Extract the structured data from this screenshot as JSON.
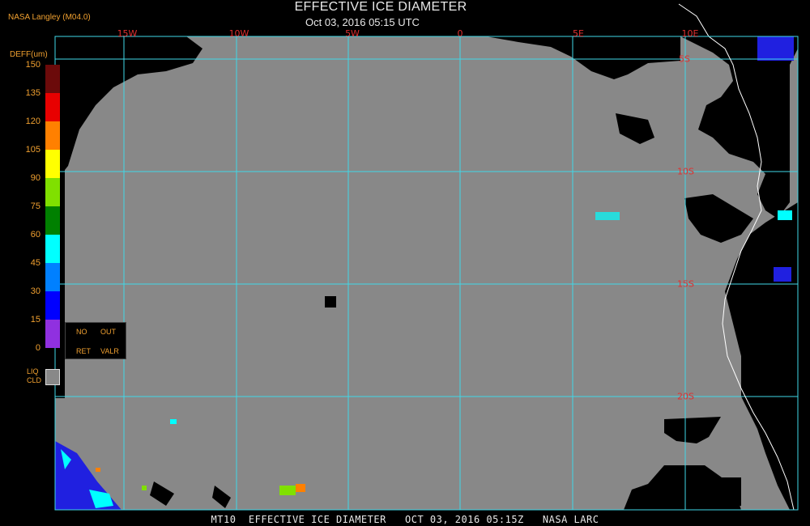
{
  "header": {
    "title": "EFFECTIVE ICE DIAMETER",
    "subtitle": "Oct 03, 2016 05:15 UTC",
    "source": "NASA Langley (M04.0)"
  },
  "map": {
    "lon_labels": [
      "15W",
      "10W",
      "5W",
      "0",
      "5E",
      "10E"
    ],
    "lat_labels": [
      "5S",
      "10S",
      "15S",
      "20S"
    ],
    "colors": {
      "liquid_cloud": "#888888",
      "clear": "#000000",
      "grid": "#40d8e8",
      "coast": "#ffffff",
      "label": "#e03030"
    }
  },
  "colorbar": {
    "unit_label": "DEFF(um)",
    "ticks": [
      "150",
      "135",
      "120",
      "105",
      "90",
      "75",
      "60",
      "45",
      "30",
      "15",
      "0"
    ],
    "bins": [
      {
        "range": "135-150",
        "color": "#6b0a0a"
      },
      {
        "range": "120-135",
        "color": "#e80000"
      },
      {
        "range": "105-120",
        "color": "#ff8000"
      },
      {
        "range": "90-105",
        "color": "#ffff00"
      },
      {
        "range": "75-90",
        "color": "#80e000"
      },
      {
        "range": "60-75",
        "color": "#008000"
      },
      {
        "range": "45-60",
        "color": "#00ffff"
      },
      {
        "range": "30-45",
        "color": "#0080ff"
      },
      {
        "range": "15-30",
        "color": "#0000ff"
      },
      {
        "range": "0-15",
        "color": "#9030e0"
      }
    ],
    "no_ret_label_1": "NO",
    "no_ret_label_2": "RET",
    "out_valr_label_1": "OUT",
    "out_valr_label_2": "VALR",
    "liq_label_1": "LIQ",
    "liq_label_2": "CLD"
  },
  "footer": {
    "text": "MT10  EFFECTIVE ICE DIAMETER   OCT 03, 2016 05:15Z   NASA LARC"
  }
}
